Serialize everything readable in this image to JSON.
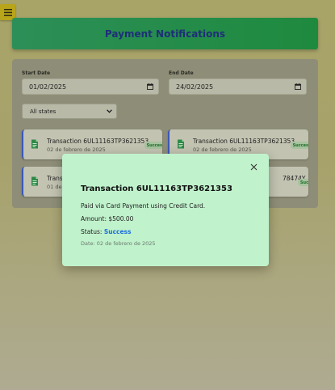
{
  "menu": {
    "icon": "hamburger-icon"
  },
  "header": {
    "title": "Payment Notifications"
  },
  "filters": {
    "start_label": "Start Date",
    "start_value": "01/02/2025",
    "end_label": "End Date",
    "end_value": "24/02/2025",
    "state_value": "All states"
  },
  "transactions": [
    {
      "title": "Transaction 6UL11163TP3621353",
      "date": "02 de febrero de 2025",
      "badge": "Success"
    },
    {
      "title": "Transaction 6UL11163TP3621353",
      "date": "02 de febrero de 2025",
      "badge": "Success"
    },
    {
      "title": "Trans",
      "date": "01 de",
      "badge": ""
    },
    {
      "title": "78474Y",
      "date": "",
      "badge": "Succ"
    }
  ],
  "modal": {
    "title": "Transaction 6UL11163TP3621353",
    "description": "Paid via Card Payment using Credit Card.",
    "amount": "Amount: $500.00",
    "status_label": "Status:",
    "status_value": "Success",
    "date": "Date: 02 de febrero de 2025"
  },
  "colors": {
    "header_bg": "#1e8a3e",
    "header_text": "#1e2f78",
    "modal_bg": "#c0f2cc",
    "status_success": "#1e6fd8",
    "card_border": "#3b57b8",
    "menu_button": "#b8a51a"
  }
}
